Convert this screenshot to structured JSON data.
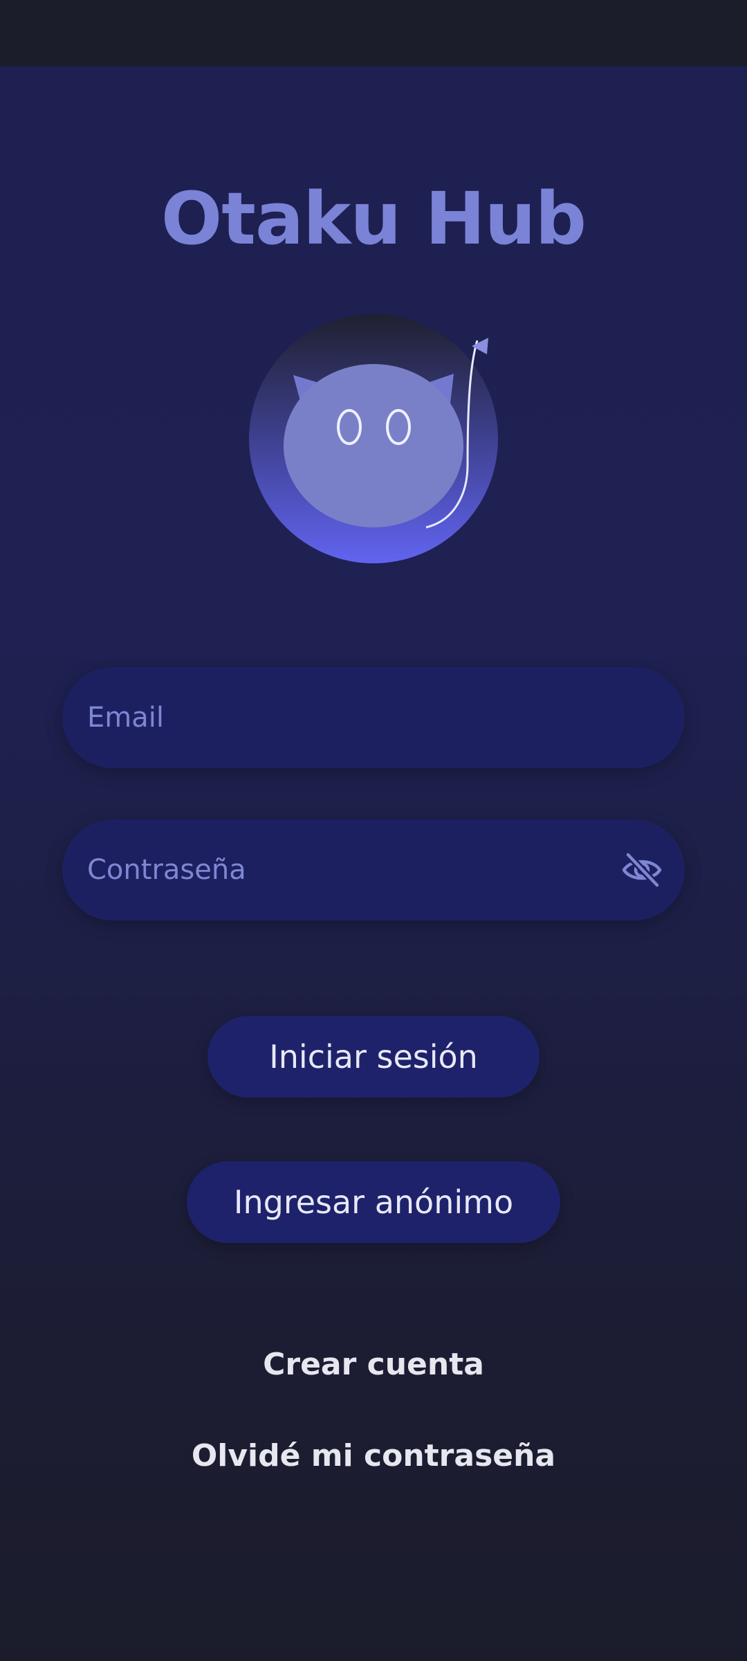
{
  "app": {
    "title": "Otaku Hub"
  },
  "logo": {
    "icon": "cat-face-logo",
    "colors": {
      "ring_outer": "#5f62ea",
      "face": "#7a80c8",
      "ears": "#7479d0"
    }
  },
  "form": {
    "email": {
      "placeholder": "Email",
      "value": ""
    },
    "password": {
      "placeholder": "Contraseña",
      "value": "",
      "toggle_icon": "eye-off-icon"
    }
  },
  "actions": {
    "login_label": "Iniciar sesión",
    "anonymous_label": "Ingresar anónimo"
  },
  "links": {
    "create_account": "Crear cuenta",
    "forgot_password": "Olvidé mi contraseña"
  },
  "theme": {
    "background": "#1d2051",
    "accent": "#7a83d6",
    "input_bg": "#1d2060",
    "button_bg": "#1e226a",
    "text_light": "#e8e9f8"
  }
}
